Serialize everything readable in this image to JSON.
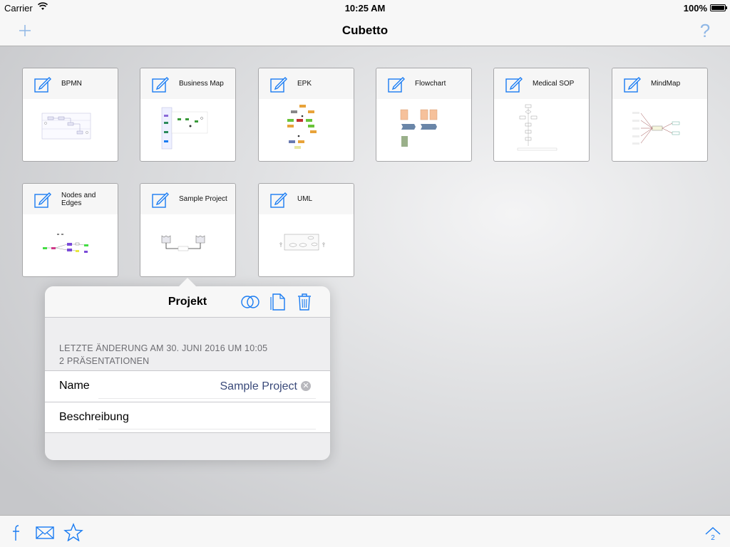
{
  "status_bar": {
    "carrier": "Carrier",
    "time": "10:25 AM",
    "battery": "100%"
  },
  "nav": {
    "title": "Cubetto",
    "add_icon": "plus-icon",
    "help_icon": "question-mark-icon"
  },
  "projects": [
    {
      "name": "BPMN"
    },
    {
      "name": "Business Map"
    },
    {
      "name": "EPK"
    },
    {
      "name": "Flowchart"
    },
    {
      "name": "Medical SOP"
    },
    {
      "name": "MindMap"
    },
    {
      "name": "Nodes and Edges"
    },
    {
      "name": "Sample Project"
    },
    {
      "name": "UML"
    }
  ],
  "popover": {
    "title": "Projekt",
    "actions": [
      "venn-circles-icon",
      "document-icon",
      "trash-icon"
    ],
    "last_modified": "LETZTE ÄNDERUNG AM 30. JUNI 2016 UM 10:05",
    "presentations": "2 PRÄSENTATIONEN",
    "name_label": "Name",
    "name_value": "Sample Project",
    "description_label": "Beschreibung",
    "description_value": ""
  },
  "toolbar": {
    "icons": [
      "facebook-icon",
      "mail-icon",
      "star-icon",
      "up-arrow-icon"
    ],
    "up_count": "2"
  },
  "colors": {
    "accent": "#1a7cf2",
    "tile_border": "#a7a7a9"
  }
}
